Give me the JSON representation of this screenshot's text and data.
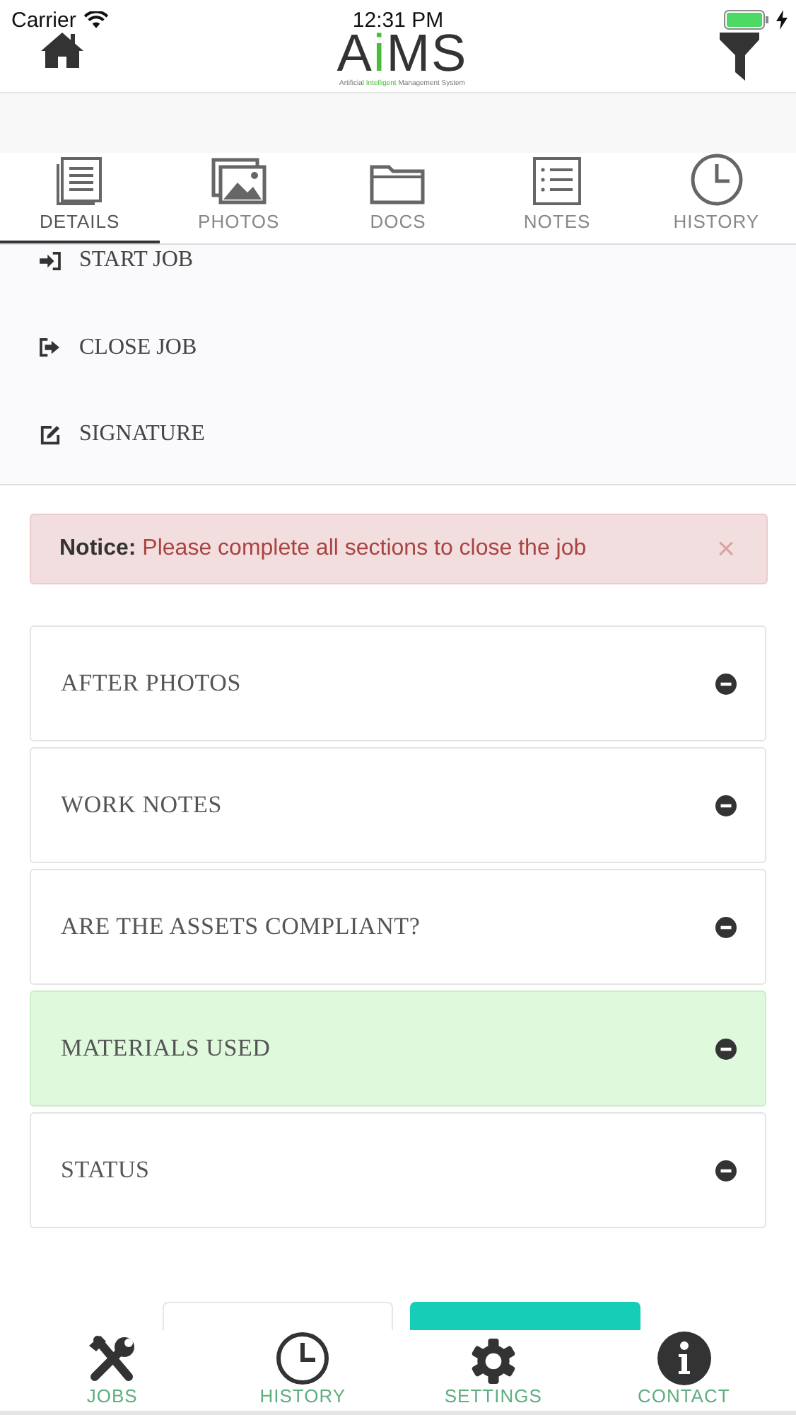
{
  "status_bar": {
    "carrier": "Carrier",
    "time": "12:31 PM",
    "charging": true
  },
  "header": {
    "logo_parts": [
      {
        "text": "A",
        "highlighted": false
      },
      {
        "text": "i",
        "highlighted": true
      },
      {
        "text": "MS",
        "highlighted": false
      }
    ],
    "tagline_parts": [
      {
        "text": "Artificial ",
        "highlighted": false
      },
      {
        "text": "Intelligent",
        "highlighted": true
      },
      {
        "text": " Management System",
        "highlighted": false
      }
    ]
  },
  "tabs": [
    {
      "label": "DETAILS",
      "kind": "details",
      "selected": true
    },
    {
      "label": "PHOTOS",
      "kind": "photos",
      "selected": false
    },
    {
      "label": "DOCS",
      "kind": "docs",
      "selected": false
    },
    {
      "label": "NOTES",
      "kind": "notes",
      "selected": false
    },
    {
      "label": "HISTORY",
      "kind": "history",
      "selected": false
    }
  ],
  "actions": [
    {
      "label": "START JOB",
      "kind": "start"
    },
    {
      "label": "CLOSE JOB",
      "kind": "close"
    },
    {
      "label": "SIGNATURE",
      "kind": "signature"
    }
  ],
  "notice": {
    "title": "Notice:",
    "message": "Please complete all sections to close the job",
    "close": "×"
  },
  "sections": [
    {
      "title": "AFTER PHOTOS",
      "complete": false
    },
    {
      "title": "WORK NOTES",
      "complete": false
    },
    {
      "title": "ARE THE ASSETS COMPLIANT?",
      "complete": false
    },
    {
      "title": "MATERIALS USED",
      "complete": true
    },
    {
      "title": "STATUS",
      "complete": false
    }
  ],
  "bottom_nav": [
    {
      "label": "JOBS",
      "kind": "jobs"
    },
    {
      "label": "HISTORY",
      "kind": "history"
    },
    {
      "label": "SETTINGS",
      "kind": "settings"
    },
    {
      "label": "CONTACT",
      "kind": "contact"
    }
  ]
}
